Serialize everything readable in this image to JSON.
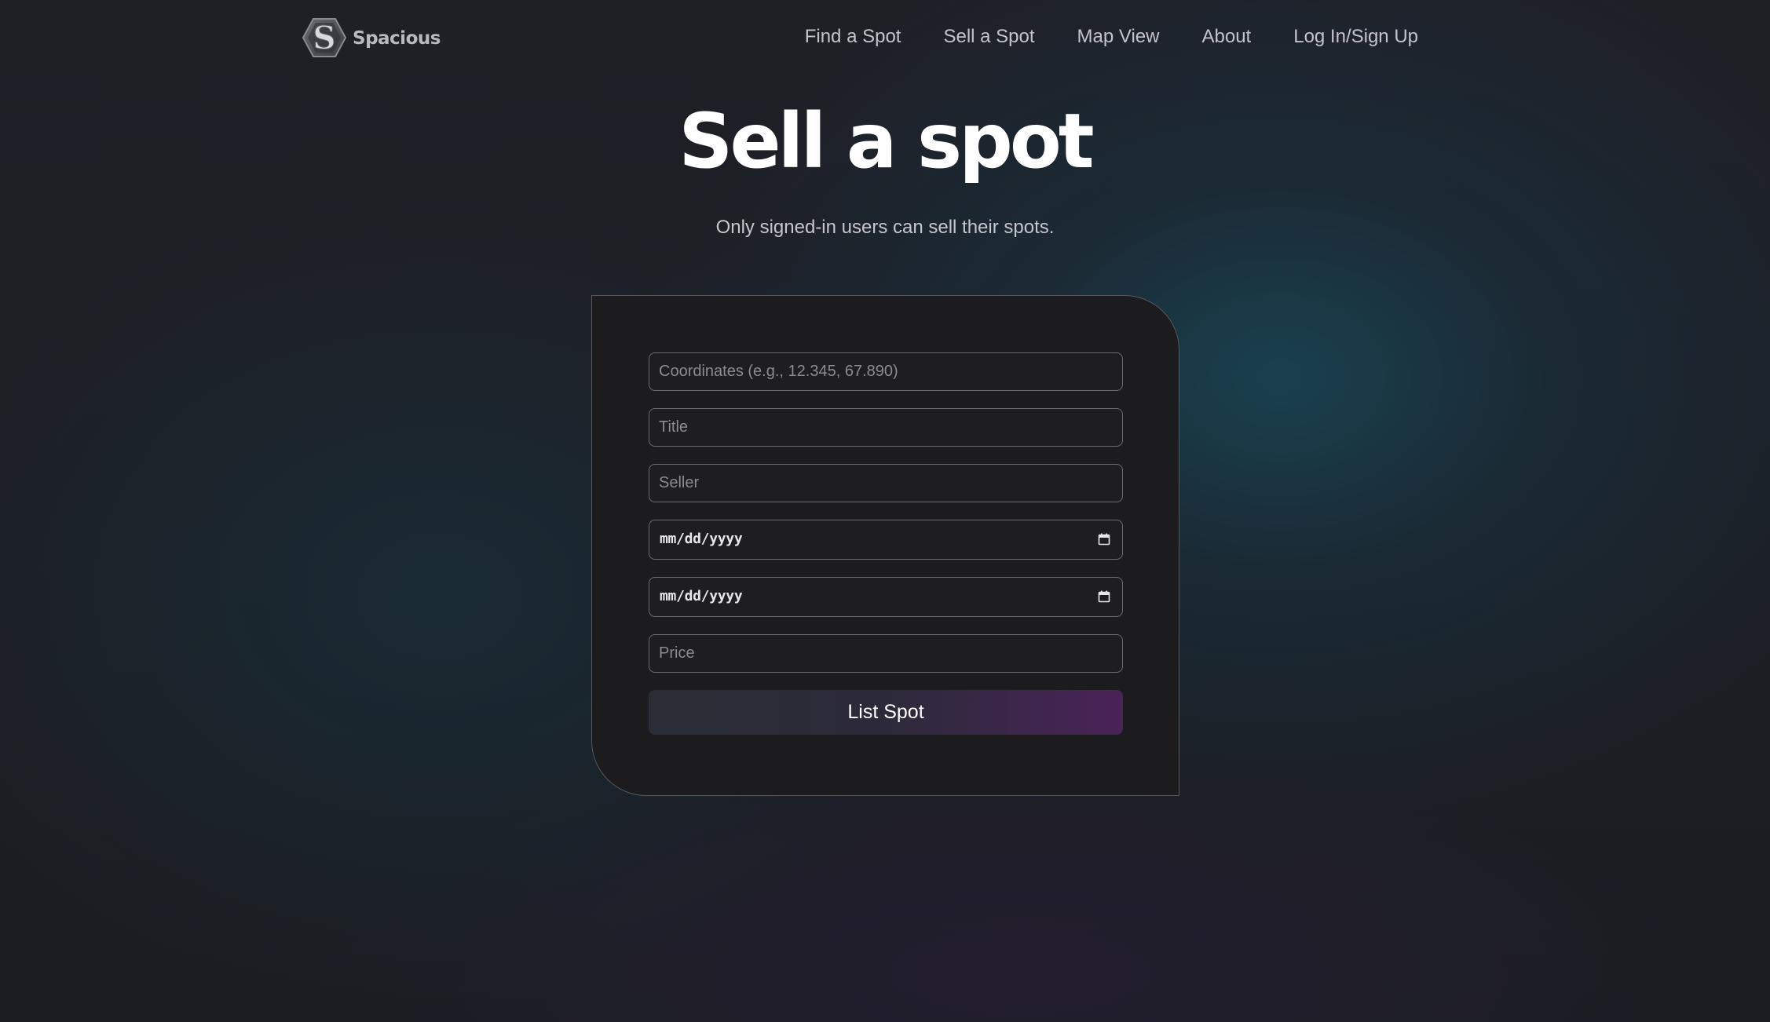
{
  "header": {
    "logo_text": "Spacious",
    "nav": [
      {
        "label": "Find a Spot"
      },
      {
        "label": "Sell a Spot"
      },
      {
        "label": "Map View"
      },
      {
        "label": "About"
      },
      {
        "label": "Log In/Sign Up"
      }
    ]
  },
  "hero": {
    "title": "Sell a spot",
    "subtitle": "Only signed-in users can sell their spots."
  },
  "form": {
    "coordinates": {
      "placeholder": "Coordinates (e.g., 12.345, 67.890)",
      "value": ""
    },
    "title": {
      "placeholder": "Title",
      "value": ""
    },
    "seller": {
      "placeholder": "Seller",
      "value": ""
    },
    "start_date": {
      "display": "mm/dd/yyyy",
      "icon": "calendar-icon"
    },
    "end_date": {
      "display": "mm/dd/yyyy",
      "icon": "calendar-icon"
    },
    "price": {
      "placeholder": "Price",
      "value": ""
    },
    "submit_label": "List Spot"
  },
  "colors": {
    "background": "#1c1c20",
    "card_background": "#1c1c1e",
    "card_border": "#56565c",
    "nav_text": "#c3c3cb",
    "button_gradient_start": "#2a2d35",
    "button_gradient_end": "#4a2358"
  }
}
